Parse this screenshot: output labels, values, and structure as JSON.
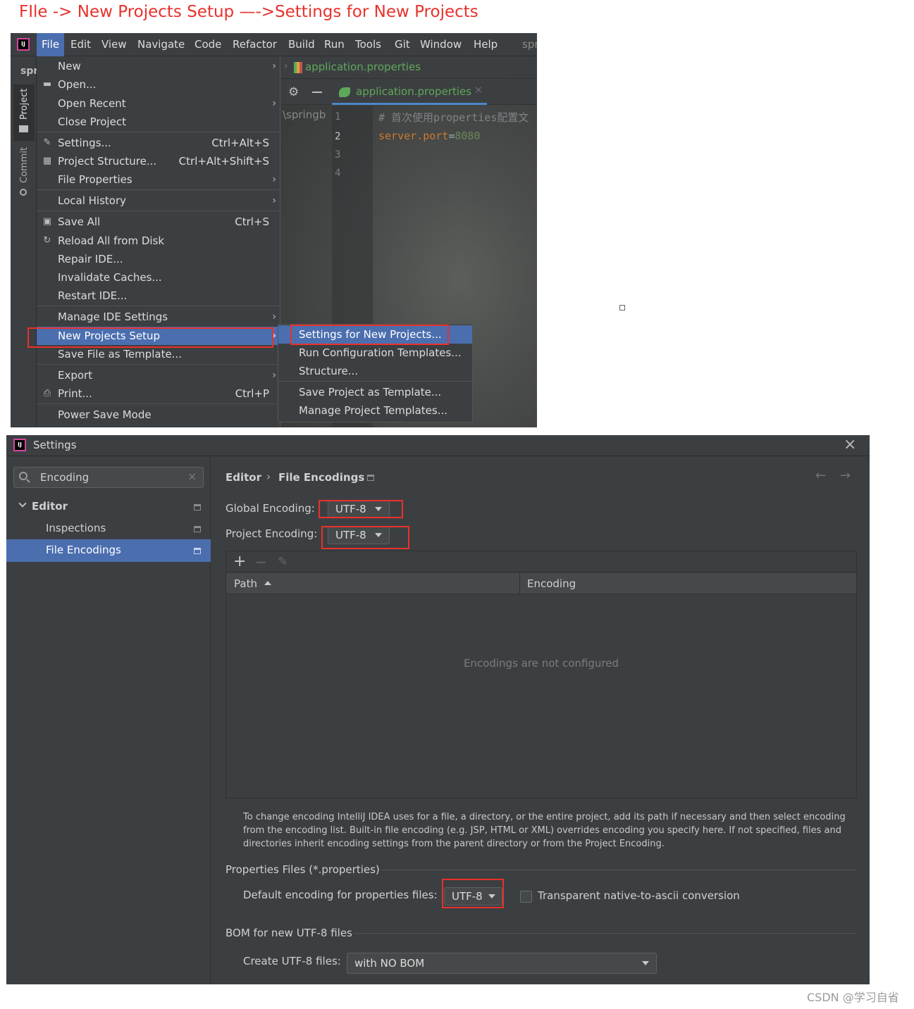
{
  "caption": "FIle -> New Projects Setup —->Settings for New Projects",
  "colors": {
    "accent": "#4b6eaf",
    "annotation_red": "#e8312c",
    "dark_bg": "#3c3f41",
    "green": "#5fa85a"
  },
  "ide": {
    "logo": "IJ",
    "menubar": [
      "File",
      "Edit",
      "View",
      "Navigate",
      "Code",
      "Refactor",
      "Build",
      "Run",
      "Tools",
      "Git",
      "Window",
      "Help",
      "spr"
    ],
    "project_stub": "spr",
    "side_tabs": {
      "project": "Project",
      "commit": "Commit"
    },
    "breadcrumb_file": "application.properties",
    "editor_tab": "application.properties",
    "path_fragment": "\\springb",
    "line_numbers": [
      "1",
      "2",
      "3",
      "4"
    ],
    "code": {
      "line1": "# 首次使用properties配置文",
      "line2_key": "server.port",
      "line2_eq": "=",
      "line2_val": "8080"
    },
    "file_menu": [
      {
        "label": "New",
        "shortcut": "",
        "submenu": true,
        "icon": ""
      },
      {
        "label": "Open...",
        "shortcut": "",
        "submenu": false,
        "icon": "folder-icon"
      },
      {
        "label": "Open Recent",
        "shortcut": "",
        "submenu": true,
        "icon": ""
      },
      {
        "label": "Close Project",
        "shortcut": "",
        "submenu": false,
        "icon": ""
      },
      {
        "label": "Settings...",
        "shortcut": "Ctrl+Alt+S",
        "submenu": false,
        "icon": "wrench-icon"
      },
      {
        "label": "Project Structure...",
        "shortcut": "Ctrl+Alt+Shift+S",
        "submenu": false,
        "icon": "project-structure-icon"
      },
      {
        "label": "File Properties",
        "shortcut": "",
        "submenu": true,
        "icon": ""
      },
      {
        "label": "Local History",
        "shortcut": "",
        "submenu": true,
        "icon": ""
      },
      {
        "label": "Save All",
        "shortcut": "Ctrl+S",
        "submenu": false,
        "icon": "save-icon"
      },
      {
        "label": "Reload All from Disk",
        "shortcut": "",
        "submenu": false,
        "icon": "reload-icon"
      },
      {
        "label": "Repair IDE...",
        "shortcut": "",
        "submenu": false,
        "icon": ""
      },
      {
        "label": "Invalidate Caches...",
        "shortcut": "",
        "submenu": false,
        "icon": ""
      },
      {
        "label": "Restart IDE...",
        "shortcut": "",
        "submenu": false,
        "icon": ""
      },
      {
        "label": "Manage IDE Settings",
        "shortcut": "",
        "submenu": true,
        "icon": ""
      },
      {
        "label": "New Projects Setup",
        "shortcut": "",
        "submenu": true,
        "icon": ""
      },
      {
        "label": "Save File as Template...",
        "shortcut": "",
        "submenu": false,
        "icon": ""
      },
      {
        "label": "Export",
        "shortcut": "",
        "submenu": true,
        "icon": ""
      },
      {
        "label": "Print...",
        "shortcut": "Ctrl+P",
        "submenu": false,
        "icon": "print-icon"
      },
      {
        "label": "Power Save Mode",
        "shortcut": "",
        "submenu": false,
        "icon": ""
      }
    ],
    "new_projects_submenu": [
      "Settings for New Projects...",
      "Run Configuration Templates...",
      "Structure...",
      "Save Project as Template...",
      "Manage Project Templates..."
    ]
  },
  "settings": {
    "title": "Settings",
    "search": {
      "value": "Encoding"
    },
    "tree": {
      "editor": "Editor",
      "inspections": "Inspections",
      "file_encodings": "File Encodings"
    },
    "breadcrumb": {
      "parent": "Editor",
      "sep": "›",
      "current": "File Encodings"
    },
    "global_encoding": {
      "label": "Global Encoding:",
      "value": "UTF-8"
    },
    "project_encoding": {
      "label": "Project Encoding:",
      "value": "UTF-8"
    },
    "toolbar": {
      "add": "+",
      "remove": "−"
    },
    "table": {
      "col_path": "Path",
      "col_encoding": "Encoding",
      "empty": "Encodings are not configured"
    },
    "help_text": "To change encoding IntelliJ IDEA uses for a file, a directory, or the entire project, add its path if necessary and then select encoding from the encoding list. Built-in file encoding (e.g. JSP, HTML or XML) overrides encoding you specify here. If not specified, files and directories inherit encoding settings from the parent directory or from the Project Encoding.",
    "properties_section": "Properties Files (*.properties)",
    "default_props": {
      "label": "Default encoding for properties files:",
      "value": "UTF-8"
    },
    "transparent": {
      "label": "Transparent native-to-ascii conversion",
      "checked": false
    },
    "bom_section": "BOM for new UTF-8 files",
    "create_utf8": {
      "label": "Create UTF-8 files:",
      "value": "with NO BOM"
    }
  },
  "watermark": "CSDN @学习自省"
}
